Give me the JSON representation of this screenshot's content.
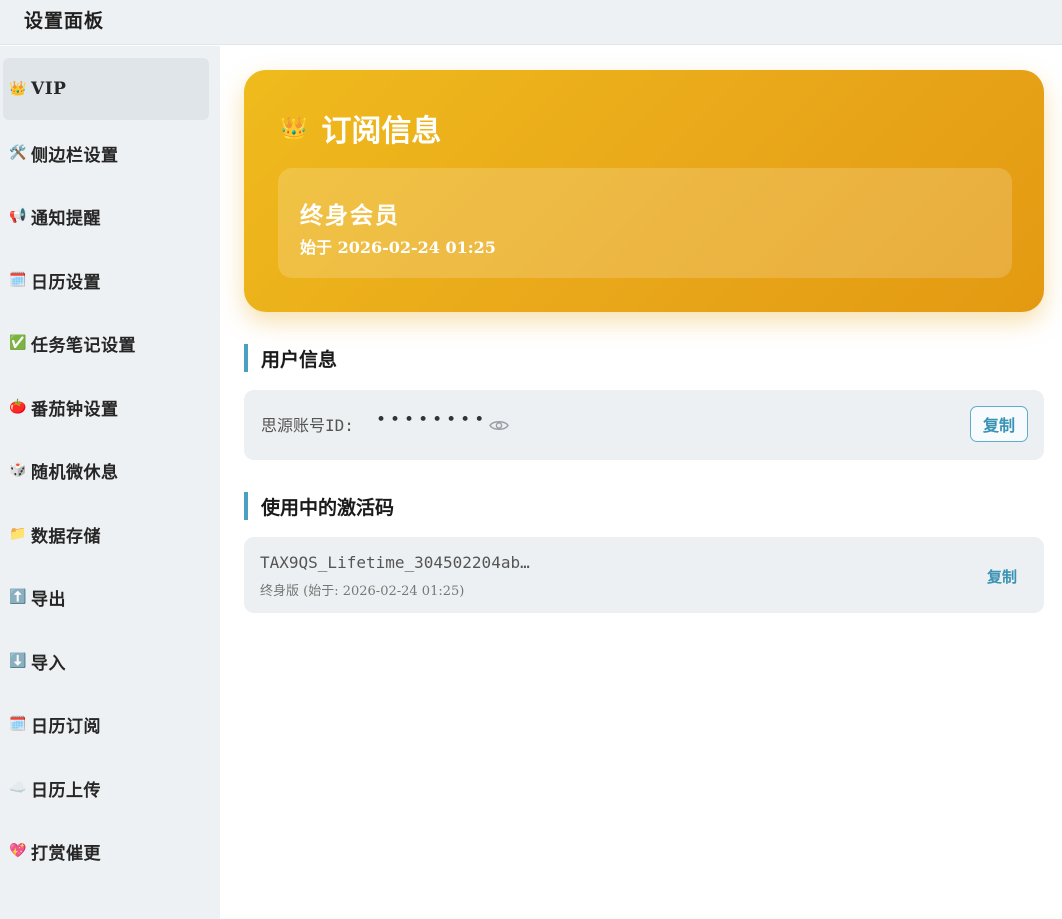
{
  "window": {
    "title": "设置面板"
  },
  "sidebar": {
    "items": [
      {
        "icon": "👑",
        "label": "VIP",
        "active": true
      },
      {
        "icon": "🛠️",
        "label": "侧边栏设置"
      },
      {
        "icon": "📢",
        "label": "通知提醒"
      },
      {
        "icon": "🗓️",
        "label": "日历设置"
      },
      {
        "icon": "✅",
        "label": "任务笔记设置"
      },
      {
        "icon": "🍅",
        "label": "番茄钟设置"
      },
      {
        "icon": "🎲",
        "label": "随机微休息"
      },
      {
        "icon": "📁",
        "label": "数据存储"
      },
      {
        "icon": "⬆️",
        "label": "导出"
      },
      {
        "icon": "⬇️",
        "label": "导入"
      },
      {
        "icon": "🗓️",
        "label": "日历订阅"
      },
      {
        "icon": "☁️",
        "label": "日历上传"
      },
      {
        "icon": "💖",
        "label": "打赏催更"
      }
    ]
  },
  "subscription": {
    "icon": "👑",
    "title": "订阅信息",
    "plan": "终身会员",
    "since": "始于 2026-02-24 01:25",
    "colors": {
      "start": "#efbb1c",
      "end": "#e39a12"
    }
  },
  "user_info": {
    "section_title": "用户信息",
    "account_label": "思源账号ID:",
    "masked_value": "••••••••",
    "copy_label": "复制"
  },
  "activation": {
    "section_title": "使用中的激活码",
    "code": "TAX9QS_Lifetime_304502204ab…",
    "detail": "终身版 (始于: 2026-02-24 01:25)",
    "copy_label": "复制"
  },
  "accent_color": "#4aa0c0"
}
